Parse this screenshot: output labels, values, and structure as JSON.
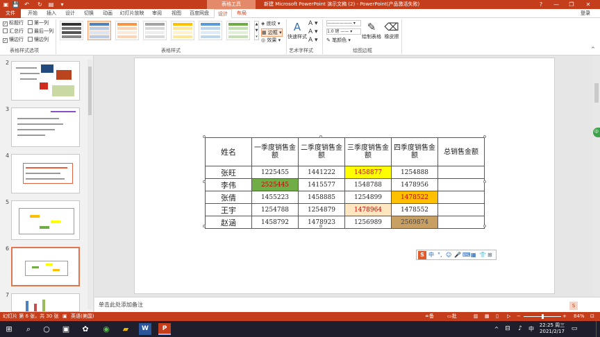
{
  "titlebar": {
    "context_tools": "表格工具",
    "title": "新建 Microsoft PowerPoint 演示文稿 (2) - PowerPoint(产品激活失败)",
    "help": "?",
    "minimize": "—",
    "restore": "❐",
    "close": "✕"
  },
  "tabs": {
    "file": "文件",
    "items": [
      "开始",
      "插入",
      "设计",
      "切换",
      "动画",
      "幻灯片放映",
      "审阅",
      "视图",
      "百度网盘"
    ],
    "ctx_design": "设计",
    "ctx_layout": "布局",
    "login": "登录"
  },
  "ribbon": {
    "options": {
      "header_row": "标题行",
      "first_column": "第一列",
      "total_row": "汇总行",
      "last_column": "最后一列",
      "banded_rows": "镶边行",
      "banded_columns": "镶边列",
      "group_label": "表格样式选项"
    },
    "styles": {
      "group_label": "表格样式",
      "shading": "底纹",
      "borders": "边框",
      "effects": "效果"
    },
    "wordart": {
      "quick_styles": "快速样式",
      "group_label": "艺术字样式"
    },
    "borders_group": {
      "pen_weight": "1.0 磅",
      "pen_color": "笔颜色",
      "draw_table": "绘制表格",
      "eraser": "橡皮擦",
      "group_label": "绘图边框"
    }
  },
  "slides": {
    "numbers": [
      "2",
      "3",
      "4",
      "5",
      "6",
      "7"
    ],
    "selected_index": 4
  },
  "table": {
    "header": [
      "姓名",
      "一季度销售金额",
      "二季度销售金额",
      "三季度销售金额",
      "四季度销售金额",
      "总销售金额"
    ],
    "rows": [
      [
        "张旺",
        "1225455",
        "1441222",
        "1458877",
        "1254888",
        ""
      ],
      [
        "李伟",
        "2525445",
        "1415577",
        "1548788",
        "1478956",
        ""
      ],
      [
        "张倩",
        "1455223",
        "1458885",
        "1254899",
        "1478522",
        ""
      ],
      [
        "王宇",
        "1254788",
        "1254879",
        "1478964",
        "1478552",
        ""
      ],
      [
        "赵涵",
        "1458792",
        "1478923",
        "1256989",
        "2569874",
        ""
      ]
    ],
    "highlight_colors": {
      "yellow": "#ffff00",
      "green": "#70ad47",
      "orange": "#ffc000",
      "peach": "#fde6c0",
      "brown": "#c9a063",
      "red_text": "#c00000"
    }
  },
  "ime": {
    "logo": "S",
    "mode": "中"
  },
  "notes": {
    "placeholder": "单击此处添加备注"
  },
  "status": {
    "slide_info": "幻灯片 第 6 张，共 30 张",
    "language": "英语(美国)",
    "notes_btn": "备注",
    "comments_btn": "批注",
    "zoom": "84%"
  },
  "taskbar": {
    "time": "22:25 周三",
    "date": "2021/2/17"
  },
  "colors": {
    "accent": "#c43e1c",
    "ribbon_bg": "#ffffff",
    "pane_bg": "#e6e6e6"
  }
}
